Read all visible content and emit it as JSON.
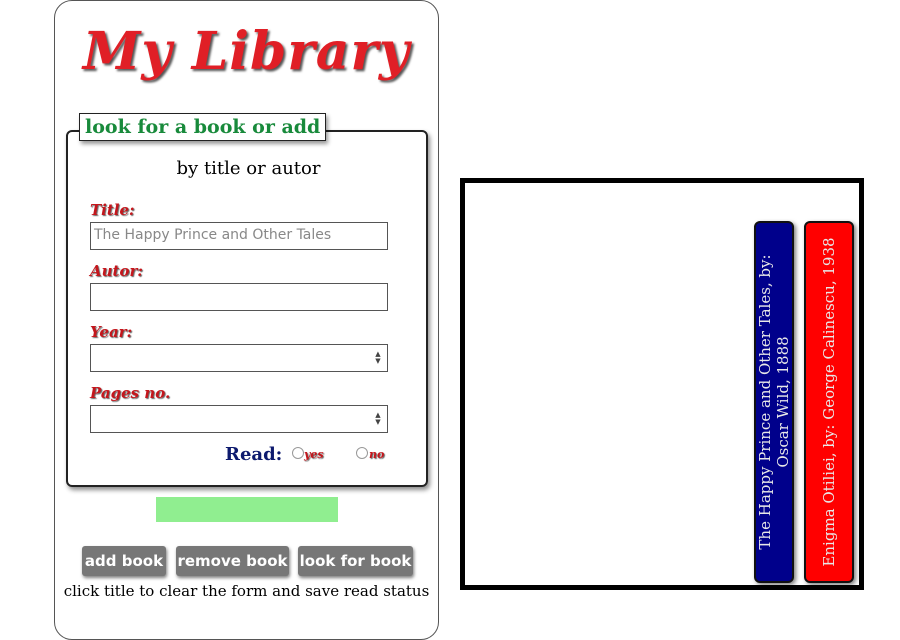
{
  "app": {
    "title": "My Library"
  },
  "form": {
    "legend": "look for a book or add",
    "subtitle": "by title or autor",
    "fields": [
      {
        "label": "Title:",
        "value": "",
        "placeholder": "The Happy Prince and Other Tales"
      },
      {
        "label": "Autor:",
        "value": "",
        "placeholder": ""
      },
      {
        "label": "Year:",
        "value": "",
        "placeholder": ""
      },
      {
        "label": "Pages no.",
        "value": "",
        "placeholder": ""
      }
    ],
    "read": {
      "label": "Read:",
      "options": [
        "yes",
        "no"
      ]
    }
  },
  "buttons": {
    "add": "add book",
    "remove": "remove book",
    "look": "look for book"
  },
  "hint": "click title to clear the form and save read status",
  "shelf": {
    "books": [
      {
        "text": "The Happy Prince and Other Tales, by: Oscar Wild, 1888",
        "color": "#00008b"
      },
      {
        "text": "Enigma Otiliei, by: George Calinescu, 1938",
        "color": "#ff0000"
      }
    ]
  },
  "colors": {
    "title": "#e01f26",
    "legend": "#188a3b",
    "status": "#90ee90",
    "button": "#777777"
  }
}
